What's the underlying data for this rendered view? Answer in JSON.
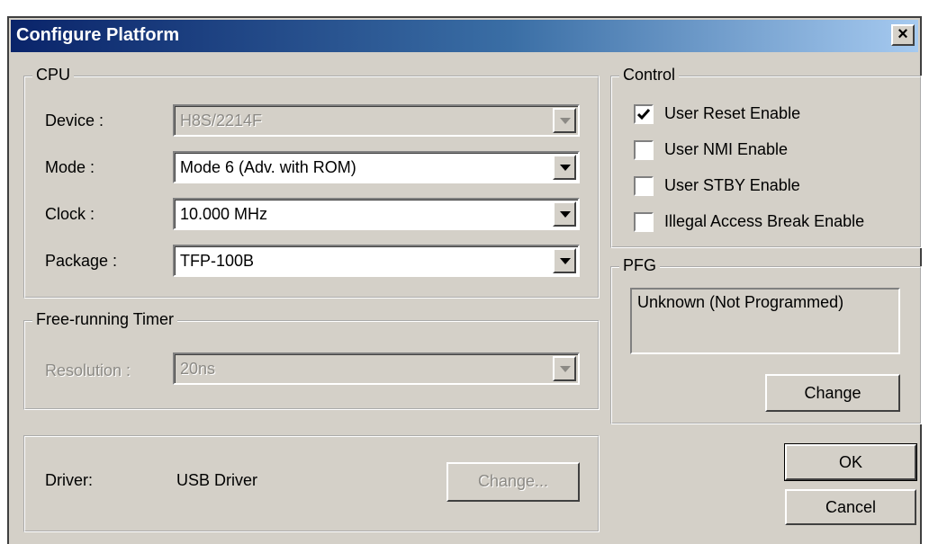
{
  "window": {
    "title": "Configure Platform",
    "close_glyph": "×"
  },
  "cpu": {
    "group_title": "CPU",
    "device_label": "Device :",
    "device_value": "H8S/2214F",
    "mode_label": "Mode :",
    "mode_value": "Mode 6  (Adv. with ROM)",
    "clock_label": "Clock :",
    "clock_value": "10.000 MHz",
    "package_label": "Package :",
    "package_value": "TFP-100B"
  },
  "timer": {
    "group_title": "Free-running Timer",
    "resolution_label": "Resolution :",
    "resolution_value": "20ns"
  },
  "driver": {
    "label": "Driver:",
    "value": "USB Driver",
    "change_button": "Change..."
  },
  "control": {
    "group_title": "Control",
    "items": [
      {
        "label": "User Reset Enable",
        "checked": true
      },
      {
        "label": "User NMI Enable",
        "checked": false
      },
      {
        "label": "User STBY Enable",
        "checked": false
      },
      {
        "label": "Illegal Access Break Enable",
        "checked": false
      }
    ]
  },
  "pfg": {
    "group_title": "PFG",
    "value": "Unknown (Not Programmed)",
    "change_button": "Change"
  },
  "buttons": {
    "ok": "OK",
    "cancel": "Cancel"
  },
  "icons": {
    "dropdown": "chevron-down-icon",
    "check": "check-icon",
    "close": "close-icon"
  }
}
